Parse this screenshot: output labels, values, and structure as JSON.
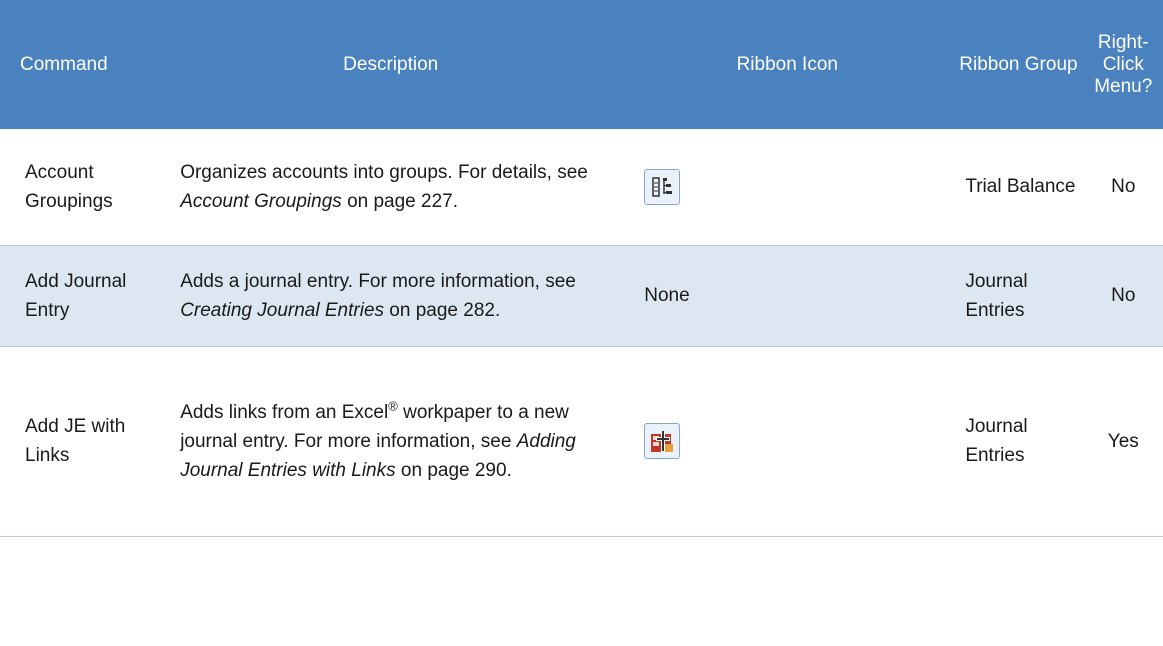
{
  "headers": {
    "command": "Command",
    "description": "Description",
    "ribbon_icon": "Ribbon Icon",
    "ribbon_group": "Ribbon Group",
    "right_click": "Right-Click Menu?"
  },
  "rows": [
    {
      "command": "Account Groupings",
      "desc_pre": "Organizes accounts into groups. For details, see",
      "desc_link": "Account Groupings",
      "desc_post": "on page 227.",
      "icon": "account-groupings-icon",
      "group": "Trial Balance",
      "right_click": "No"
    },
    {
      "command": "Add Journal Entry",
      "desc_pre": "Adds a journal entry. For more information, see",
      "desc_link": "Creating Journal Entries",
      "desc_post": "on page 282.",
      "icon_text": "None",
      "group": "Journal Entries",
      "right_click": "No"
    },
    {
      "command": "Add JE with Links",
      "desc_pre1": "Adds links from an Excel",
      "desc_sup": "®",
      "desc_pre2": "workpaper to a new journal entry. For more information, see",
      "desc_link": "Adding Journal Entries with Links",
      "desc_post": "on page 290.",
      "icon": "add-je-links-icon",
      "group": "Journal Entries",
      "right_click": "Yes"
    }
  ],
  "colors": {
    "header_bg": "#4a81bf",
    "alt_row_bg": "#dde7f1",
    "header_text": "#ffffff"
  }
}
